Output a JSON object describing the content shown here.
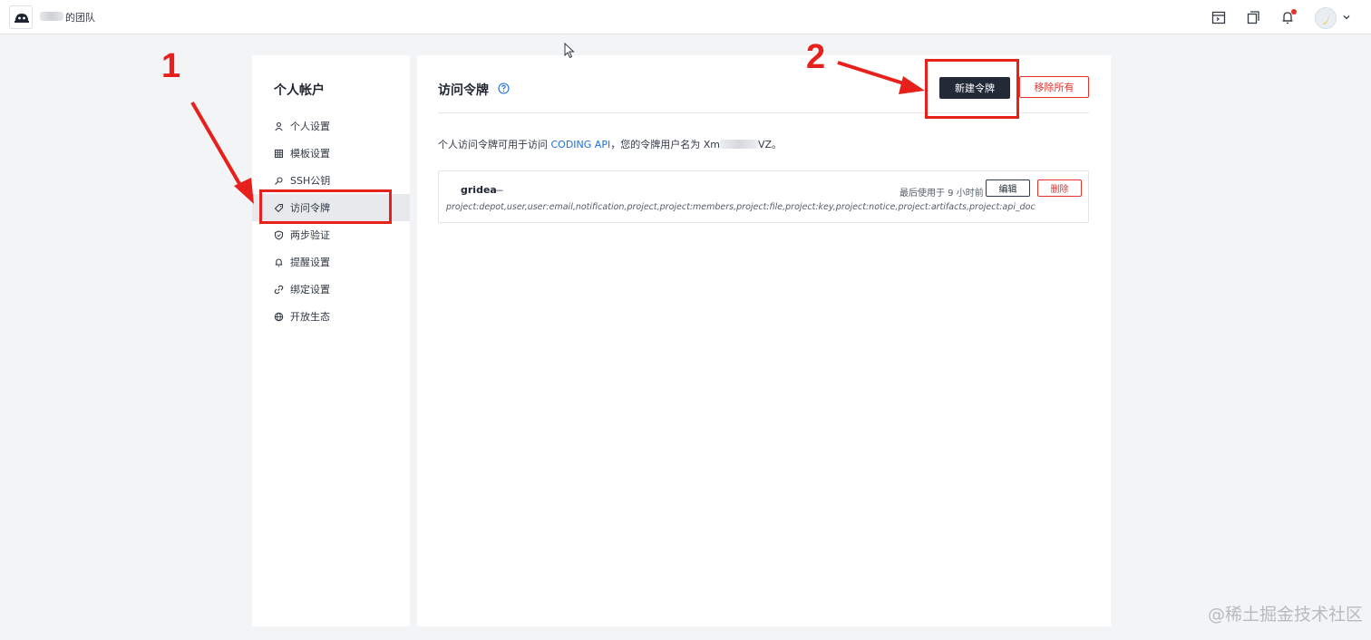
{
  "topbar": {
    "team_name": "的团队",
    "icons": [
      "calendar-icon",
      "copy-icon",
      "bell-icon",
      "avatar",
      "chevron-down-icon"
    ]
  },
  "sidebar": {
    "title": "个人帐户",
    "items": [
      {
        "label": "个人设置",
        "icon": "user-icon"
      },
      {
        "label": "模板设置",
        "icon": "grid-icon"
      },
      {
        "label": "SSH公钥",
        "icon": "key-icon"
      },
      {
        "label": "访问令牌",
        "icon": "token-icon",
        "active": true
      },
      {
        "label": "两步验证",
        "icon": "shield-icon"
      },
      {
        "label": "提醒设置",
        "icon": "bell-icon"
      },
      {
        "label": "绑定设置",
        "icon": "link-icon"
      },
      {
        "label": "开放生态",
        "icon": "globe-icon"
      }
    ]
  },
  "main": {
    "title": "访问令牌",
    "new_button": "新建令牌",
    "remove_all_button": "移除所有",
    "desc_prefix": "个人访问令牌可用于访问 ",
    "desc_link": "CODING API",
    "desc_middle": "，您的令牌用户名为 Xm",
    "desc_suffix": "VZ。",
    "token": {
      "name": "gridea",
      "dash": "—",
      "last_used": "最后使用于 9 小时前",
      "edit_button": "编辑",
      "delete_button": "删除",
      "scopes": "project:depot,user,user:email,notification,project,project:members,project:file,project:key,project:notice,project:artifacts,project:api_doc"
    }
  },
  "annotations": {
    "step1": "1",
    "step2": "2",
    "color": "#e8201c"
  },
  "watermark": "@稀土掘金技术社区",
  "colors": {
    "primary_dark": "#232a37",
    "danger": "#e5302d",
    "link": "#1d6fd9",
    "background": "#f3f4f6"
  }
}
